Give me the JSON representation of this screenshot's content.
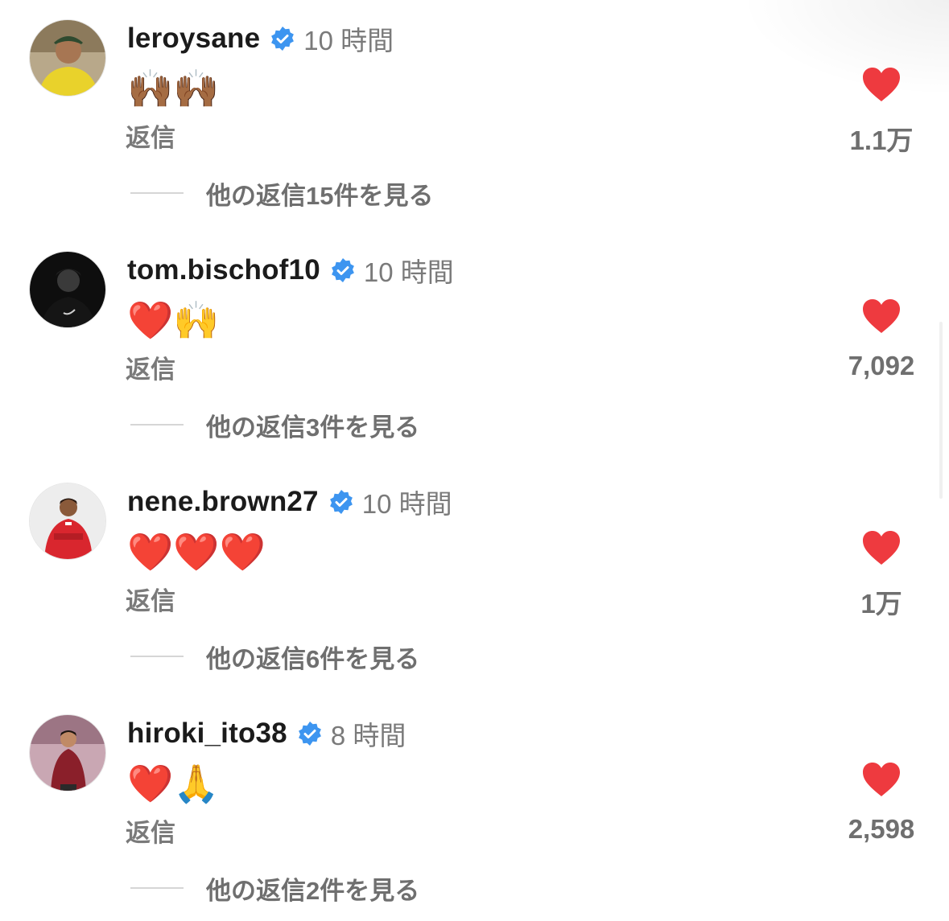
{
  "colors": {
    "verified_badge": "#3d95f0",
    "heart": "#ee3a3f",
    "secondary_text": "#7a7a7a"
  },
  "comments": [
    {
      "username": "leroysane",
      "time": "10 時間",
      "body": "🙌🏾🙌🏾",
      "reply_label": "返信",
      "likes": "1.1万",
      "more_replies": "他の返信15件を見る",
      "avatar": "leroysane-avatar",
      "verified": true
    },
    {
      "username": "tom.bischof10",
      "time": "10 時間",
      "body": "❤️🙌",
      "reply_label": "返信",
      "likes": "7,092",
      "more_replies": "他の返信3件を見る",
      "avatar": "tom-bischof-avatar",
      "verified": true
    },
    {
      "username": "nene.brown27",
      "time": "10 時間",
      "body": "❤️❤️❤️",
      "reply_label": "返信",
      "likes": "1万",
      "more_replies": "他の返信6件を見る",
      "avatar": "nene-brown-avatar",
      "verified": true
    },
    {
      "username": "hiroki_ito38",
      "time": "8 時間",
      "body": "❤️🙏",
      "reply_label": "返信",
      "likes": "2,598",
      "more_replies": "他の返信2件を見る",
      "avatar": "hiroki-ito-avatar",
      "verified": true
    }
  ]
}
